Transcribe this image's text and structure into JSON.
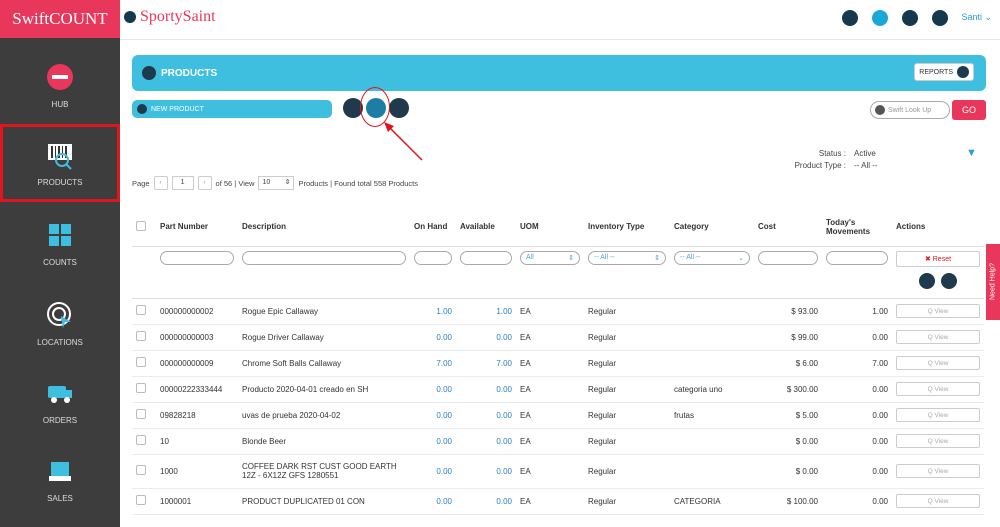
{
  "brand": "SwiftCOUNT",
  "logo_text": "SportySaint",
  "user": "Santi ⌄",
  "sidebar": {
    "items": [
      {
        "label": "HUB",
        "icon": "hub-icon"
      },
      {
        "label": "PRODUCTS",
        "icon": "barcode-icon"
      },
      {
        "label": "COUNTS",
        "icon": "counts-icon"
      },
      {
        "label": "LOCATIONS",
        "icon": "location-icon"
      },
      {
        "label": "ORDERS",
        "icon": "truck-icon"
      },
      {
        "label": "SALES",
        "icon": "sales-icon"
      }
    ]
  },
  "header": {
    "title": "PRODUCTS",
    "reports_label": "REPORTS"
  },
  "actions": {
    "new_product": "NEW PRODUCT",
    "lookup_placeholder": "Swift Look Up",
    "go_label": "GO"
  },
  "filters": {
    "status_label": "Status :",
    "status_value": "Active",
    "type_label": "Product Type :",
    "type_value": "-- All --"
  },
  "pager": {
    "page_label": "Page",
    "page_value": "1",
    "of_text": "of 56 | View",
    "view_value": "10",
    "found_text": "Products | Found total 558 Products"
  },
  "table": {
    "headers": [
      "Part Number",
      "Description",
      "On Hand",
      "Available",
      "UOM",
      "Inventory Type",
      "Category",
      "Cost",
      "Today's Movements",
      "Actions"
    ],
    "filter_uom": "All",
    "filter_inv": "-- All --",
    "filter_cat": "-- All --",
    "reset_label": "✖ Reset",
    "view_label": "Q View",
    "rows": [
      {
        "part": "000000000002",
        "desc": "Rogue Epic Callaway",
        "onhand": "1.00",
        "avail": "1.00",
        "uom": "EA",
        "inv": "Regular",
        "cat": "",
        "cost": "$ 93.00",
        "mov": "1.00"
      },
      {
        "part": "000000000003",
        "desc": "Rogue Driver Callaway",
        "onhand": "0.00",
        "avail": "0.00",
        "uom": "EA",
        "inv": "Regular",
        "cat": "",
        "cost": "$ 99.00",
        "mov": "0.00"
      },
      {
        "part": "000000000009",
        "desc": "Chrome Soft Balls Callaway",
        "onhand": "7.00",
        "avail": "7.00",
        "uom": "EA",
        "inv": "Regular",
        "cat": "",
        "cost": "$ 6.00",
        "mov": "7.00"
      },
      {
        "part": "00000222333444",
        "desc": "Producto 2020-04-01 creado en SH",
        "onhand": "0.00",
        "avail": "0.00",
        "uom": "EA",
        "inv": "Regular",
        "cat": "categoria uno",
        "cost": "$ 300.00",
        "mov": "0.00"
      },
      {
        "part": "09828218",
        "desc": "uvas de prueba 2020-04-02",
        "onhand": "0.00",
        "avail": "0.00",
        "uom": "EA",
        "inv": "Regular",
        "cat": "frutas",
        "cost": "$ 5.00",
        "mov": "0.00"
      },
      {
        "part": "10",
        "desc": "Blonde Beer",
        "onhand": "0.00",
        "avail": "0.00",
        "uom": "EA",
        "inv": "Regular",
        "cat": "",
        "cost": "$ 0.00",
        "mov": "0.00"
      },
      {
        "part": "1000",
        "desc": "COFFEE DARK RST CUST GOOD EARTH 12Z - 6X12Z GFS 1280551",
        "onhand": "0.00",
        "avail": "0.00",
        "uom": "EA",
        "inv": "Regular",
        "cat": "",
        "cost": "$ 0.00",
        "mov": "0.00"
      },
      {
        "part": "1000001",
        "desc": "PRODUCT DUPLICATED 01 CON",
        "onhand": "0.00",
        "avail": "0.00",
        "uom": "EA",
        "inv": "Regular",
        "cat": "CATEGORIA",
        "cost": "$ 100.00",
        "mov": "0.00"
      }
    ]
  },
  "help_tab": "Need Help?",
  "colors": {
    "brand": "#e8375b",
    "accent": "#3fbfe0",
    "dark": "#1e3a4c",
    "sidebar": "#3d3d3d",
    "highlight": "#e0161e"
  }
}
